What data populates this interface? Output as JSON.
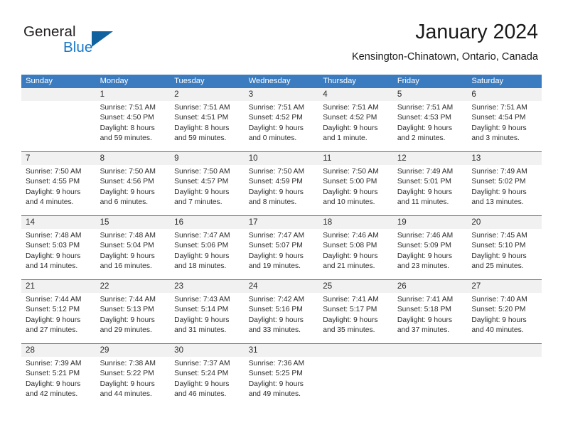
{
  "brand": {
    "name_primary": "General",
    "name_secondary": "Blue",
    "triangle_color": "#12629f",
    "blue_color": "#1878c8"
  },
  "header": {
    "title": "January 2024",
    "location": "Kensington-Chinatown, Ontario, Canada"
  },
  "theme": {
    "header_bar_color": "#3b7cc0",
    "daynum_band_color": "#f1f1f1",
    "separator_color": "#3b7cc0",
    "text_color": "#2b2b2b"
  },
  "weekdays": [
    "Sunday",
    "Monday",
    "Tuesday",
    "Wednesday",
    "Thursday",
    "Friday",
    "Saturday"
  ],
  "labels": {
    "sunrise_prefix": "Sunrise:",
    "sunset_prefix": "Sunset:",
    "daylight_prefix": "Daylight:"
  },
  "weeks": [
    {
      "days": [
        {
          "num": "",
          "empty": true
        },
        {
          "num": "1",
          "sunrise": "Sunrise: 7:51 AM",
          "sunset": "Sunset: 4:50 PM",
          "daylight_1": "Daylight: 8 hours",
          "daylight_2": "and 59 minutes."
        },
        {
          "num": "2",
          "sunrise": "Sunrise: 7:51 AM",
          "sunset": "Sunset: 4:51 PM",
          "daylight_1": "Daylight: 8 hours",
          "daylight_2": "and 59 minutes."
        },
        {
          "num": "3",
          "sunrise": "Sunrise: 7:51 AM",
          "sunset": "Sunset: 4:52 PM",
          "daylight_1": "Daylight: 9 hours",
          "daylight_2": "and 0 minutes."
        },
        {
          "num": "4",
          "sunrise": "Sunrise: 7:51 AM",
          "sunset": "Sunset: 4:52 PM",
          "daylight_1": "Daylight: 9 hours",
          "daylight_2": "and 1 minute."
        },
        {
          "num": "5",
          "sunrise": "Sunrise: 7:51 AM",
          "sunset": "Sunset: 4:53 PM",
          "daylight_1": "Daylight: 9 hours",
          "daylight_2": "and 2 minutes."
        },
        {
          "num": "6",
          "sunrise": "Sunrise: 7:51 AM",
          "sunset": "Sunset: 4:54 PM",
          "daylight_1": "Daylight: 9 hours",
          "daylight_2": "and 3 minutes."
        }
      ]
    },
    {
      "days": [
        {
          "num": "7",
          "sunrise": "Sunrise: 7:50 AM",
          "sunset": "Sunset: 4:55 PM",
          "daylight_1": "Daylight: 9 hours",
          "daylight_2": "and 4 minutes."
        },
        {
          "num": "8",
          "sunrise": "Sunrise: 7:50 AM",
          "sunset": "Sunset: 4:56 PM",
          "daylight_1": "Daylight: 9 hours",
          "daylight_2": "and 6 minutes."
        },
        {
          "num": "9",
          "sunrise": "Sunrise: 7:50 AM",
          "sunset": "Sunset: 4:57 PM",
          "daylight_1": "Daylight: 9 hours",
          "daylight_2": "and 7 minutes."
        },
        {
          "num": "10",
          "sunrise": "Sunrise: 7:50 AM",
          "sunset": "Sunset: 4:59 PM",
          "daylight_1": "Daylight: 9 hours",
          "daylight_2": "and 8 minutes."
        },
        {
          "num": "11",
          "sunrise": "Sunrise: 7:50 AM",
          "sunset": "Sunset: 5:00 PM",
          "daylight_1": "Daylight: 9 hours",
          "daylight_2": "and 10 minutes."
        },
        {
          "num": "12",
          "sunrise": "Sunrise: 7:49 AM",
          "sunset": "Sunset: 5:01 PM",
          "daylight_1": "Daylight: 9 hours",
          "daylight_2": "and 11 minutes."
        },
        {
          "num": "13",
          "sunrise": "Sunrise: 7:49 AM",
          "sunset": "Sunset: 5:02 PM",
          "daylight_1": "Daylight: 9 hours",
          "daylight_2": "and 13 minutes."
        }
      ]
    },
    {
      "days": [
        {
          "num": "14",
          "sunrise": "Sunrise: 7:48 AM",
          "sunset": "Sunset: 5:03 PM",
          "daylight_1": "Daylight: 9 hours",
          "daylight_2": "and 14 minutes."
        },
        {
          "num": "15",
          "sunrise": "Sunrise: 7:48 AM",
          "sunset": "Sunset: 5:04 PM",
          "daylight_1": "Daylight: 9 hours",
          "daylight_2": "and 16 minutes."
        },
        {
          "num": "16",
          "sunrise": "Sunrise: 7:47 AM",
          "sunset": "Sunset: 5:06 PM",
          "daylight_1": "Daylight: 9 hours",
          "daylight_2": "and 18 minutes."
        },
        {
          "num": "17",
          "sunrise": "Sunrise: 7:47 AM",
          "sunset": "Sunset: 5:07 PM",
          "daylight_1": "Daylight: 9 hours",
          "daylight_2": "and 19 minutes."
        },
        {
          "num": "18",
          "sunrise": "Sunrise: 7:46 AM",
          "sunset": "Sunset: 5:08 PM",
          "daylight_1": "Daylight: 9 hours",
          "daylight_2": "and 21 minutes."
        },
        {
          "num": "19",
          "sunrise": "Sunrise: 7:46 AM",
          "sunset": "Sunset: 5:09 PM",
          "daylight_1": "Daylight: 9 hours",
          "daylight_2": "and 23 minutes."
        },
        {
          "num": "20",
          "sunrise": "Sunrise: 7:45 AM",
          "sunset": "Sunset: 5:10 PM",
          "daylight_1": "Daylight: 9 hours",
          "daylight_2": "and 25 minutes."
        }
      ]
    },
    {
      "days": [
        {
          "num": "21",
          "sunrise": "Sunrise: 7:44 AM",
          "sunset": "Sunset: 5:12 PM",
          "daylight_1": "Daylight: 9 hours",
          "daylight_2": "and 27 minutes."
        },
        {
          "num": "22",
          "sunrise": "Sunrise: 7:44 AM",
          "sunset": "Sunset: 5:13 PM",
          "daylight_1": "Daylight: 9 hours",
          "daylight_2": "and 29 minutes."
        },
        {
          "num": "23",
          "sunrise": "Sunrise: 7:43 AM",
          "sunset": "Sunset: 5:14 PM",
          "daylight_1": "Daylight: 9 hours",
          "daylight_2": "and 31 minutes."
        },
        {
          "num": "24",
          "sunrise": "Sunrise: 7:42 AM",
          "sunset": "Sunset: 5:16 PM",
          "daylight_1": "Daylight: 9 hours",
          "daylight_2": "and 33 minutes."
        },
        {
          "num": "25",
          "sunrise": "Sunrise: 7:41 AM",
          "sunset": "Sunset: 5:17 PM",
          "daylight_1": "Daylight: 9 hours",
          "daylight_2": "and 35 minutes."
        },
        {
          "num": "26",
          "sunrise": "Sunrise: 7:41 AM",
          "sunset": "Sunset: 5:18 PM",
          "daylight_1": "Daylight: 9 hours",
          "daylight_2": "and 37 minutes."
        },
        {
          "num": "27",
          "sunrise": "Sunrise: 7:40 AM",
          "sunset": "Sunset: 5:20 PM",
          "daylight_1": "Daylight: 9 hours",
          "daylight_2": "and 40 minutes."
        }
      ]
    },
    {
      "days": [
        {
          "num": "28",
          "sunrise": "Sunrise: 7:39 AM",
          "sunset": "Sunset: 5:21 PM",
          "daylight_1": "Daylight: 9 hours",
          "daylight_2": "and 42 minutes."
        },
        {
          "num": "29",
          "sunrise": "Sunrise: 7:38 AM",
          "sunset": "Sunset: 5:22 PM",
          "daylight_1": "Daylight: 9 hours",
          "daylight_2": "and 44 minutes."
        },
        {
          "num": "30",
          "sunrise": "Sunrise: 7:37 AM",
          "sunset": "Sunset: 5:24 PM",
          "daylight_1": "Daylight: 9 hours",
          "daylight_2": "and 46 minutes."
        },
        {
          "num": "31",
          "sunrise": "Sunrise: 7:36 AM",
          "sunset": "Sunset: 5:25 PM",
          "daylight_1": "Daylight: 9 hours",
          "daylight_2": "and 49 minutes."
        },
        {
          "num": "",
          "empty": true
        },
        {
          "num": "",
          "empty": true
        },
        {
          "num": "",
          "empty": true
        }
      ]
    }
  ]
}
